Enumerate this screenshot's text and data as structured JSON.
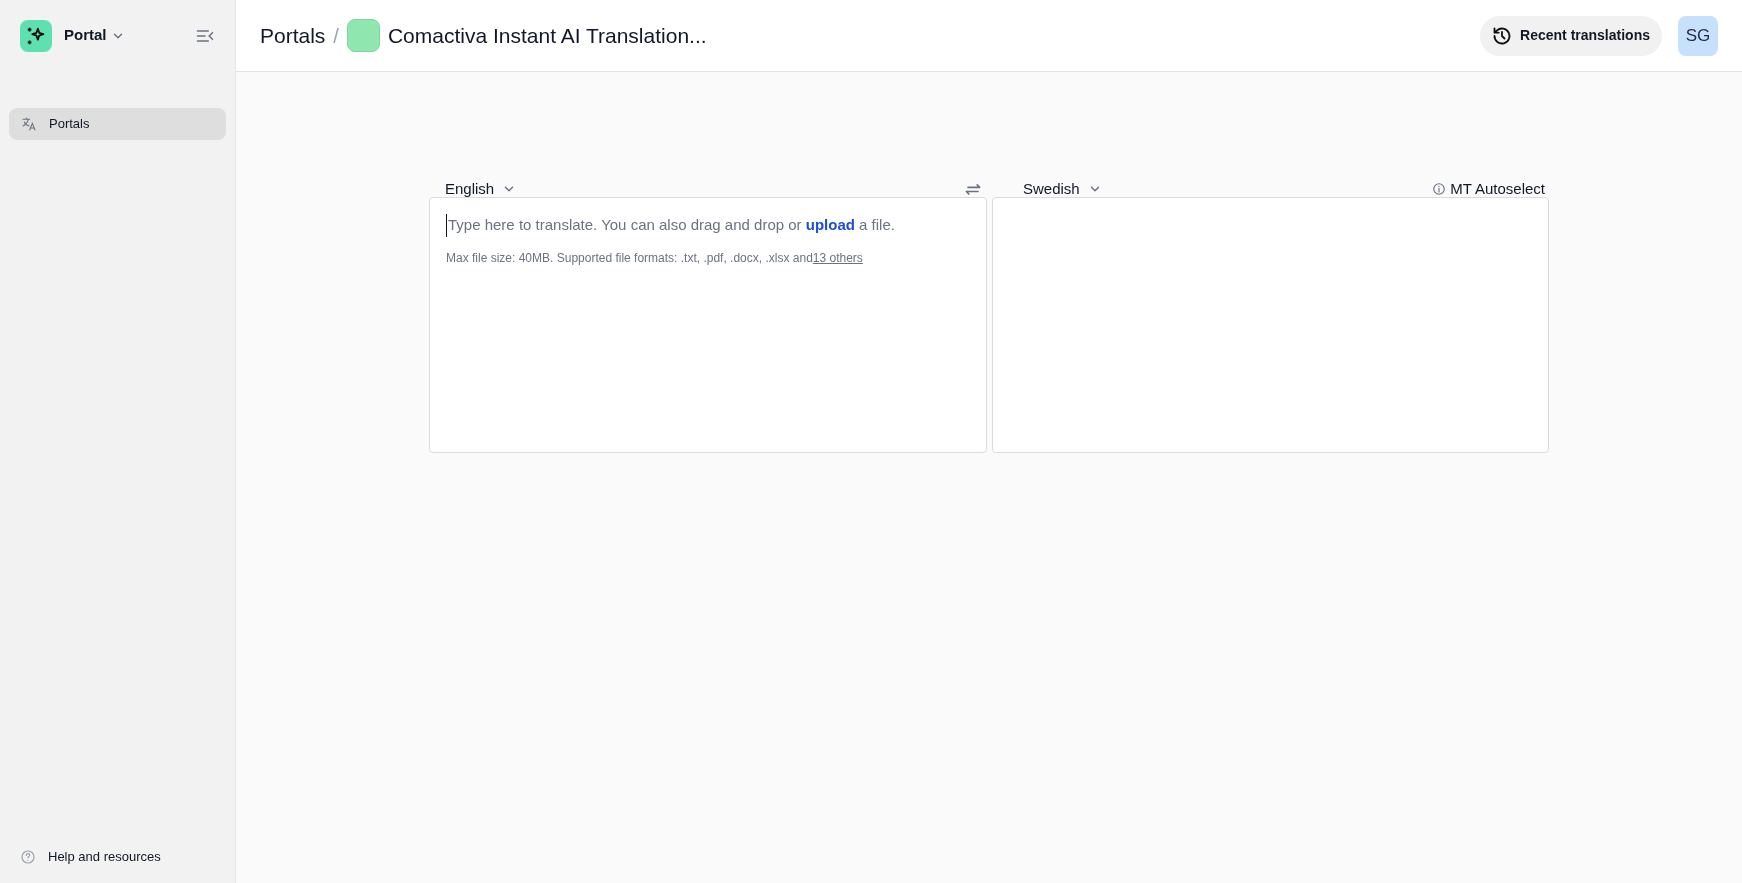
{
  "sidebar": {
    "workspace": "Portal",
    "items": [
      {
        "label": "Portals",
        "selected": true
      }
    ],
    "footer": "Help and resources"
  },
  "header": {
    "breadcrumb": "Portals",
    "separator": "/",
    "title": "Comactiva Instant AI Translation...",
    "recent_button": "Recent translations",
    "avatar": "SG"
  },
  "translator": {
    "source_language": "English",
    "target_language": "Swedish",
    "engine": "MT Autoselect",
    "placeholder_start": "Type here to translate. You can also drag and drop or",
    "upload_link": "upload",
    "placeholder_end": "a file.",
    "file_info": "Max file size: 40MB. Supported file formats: .txt, .pdf, .docx, .xlsx and",
    "others_link": "13 others"
  }
}
